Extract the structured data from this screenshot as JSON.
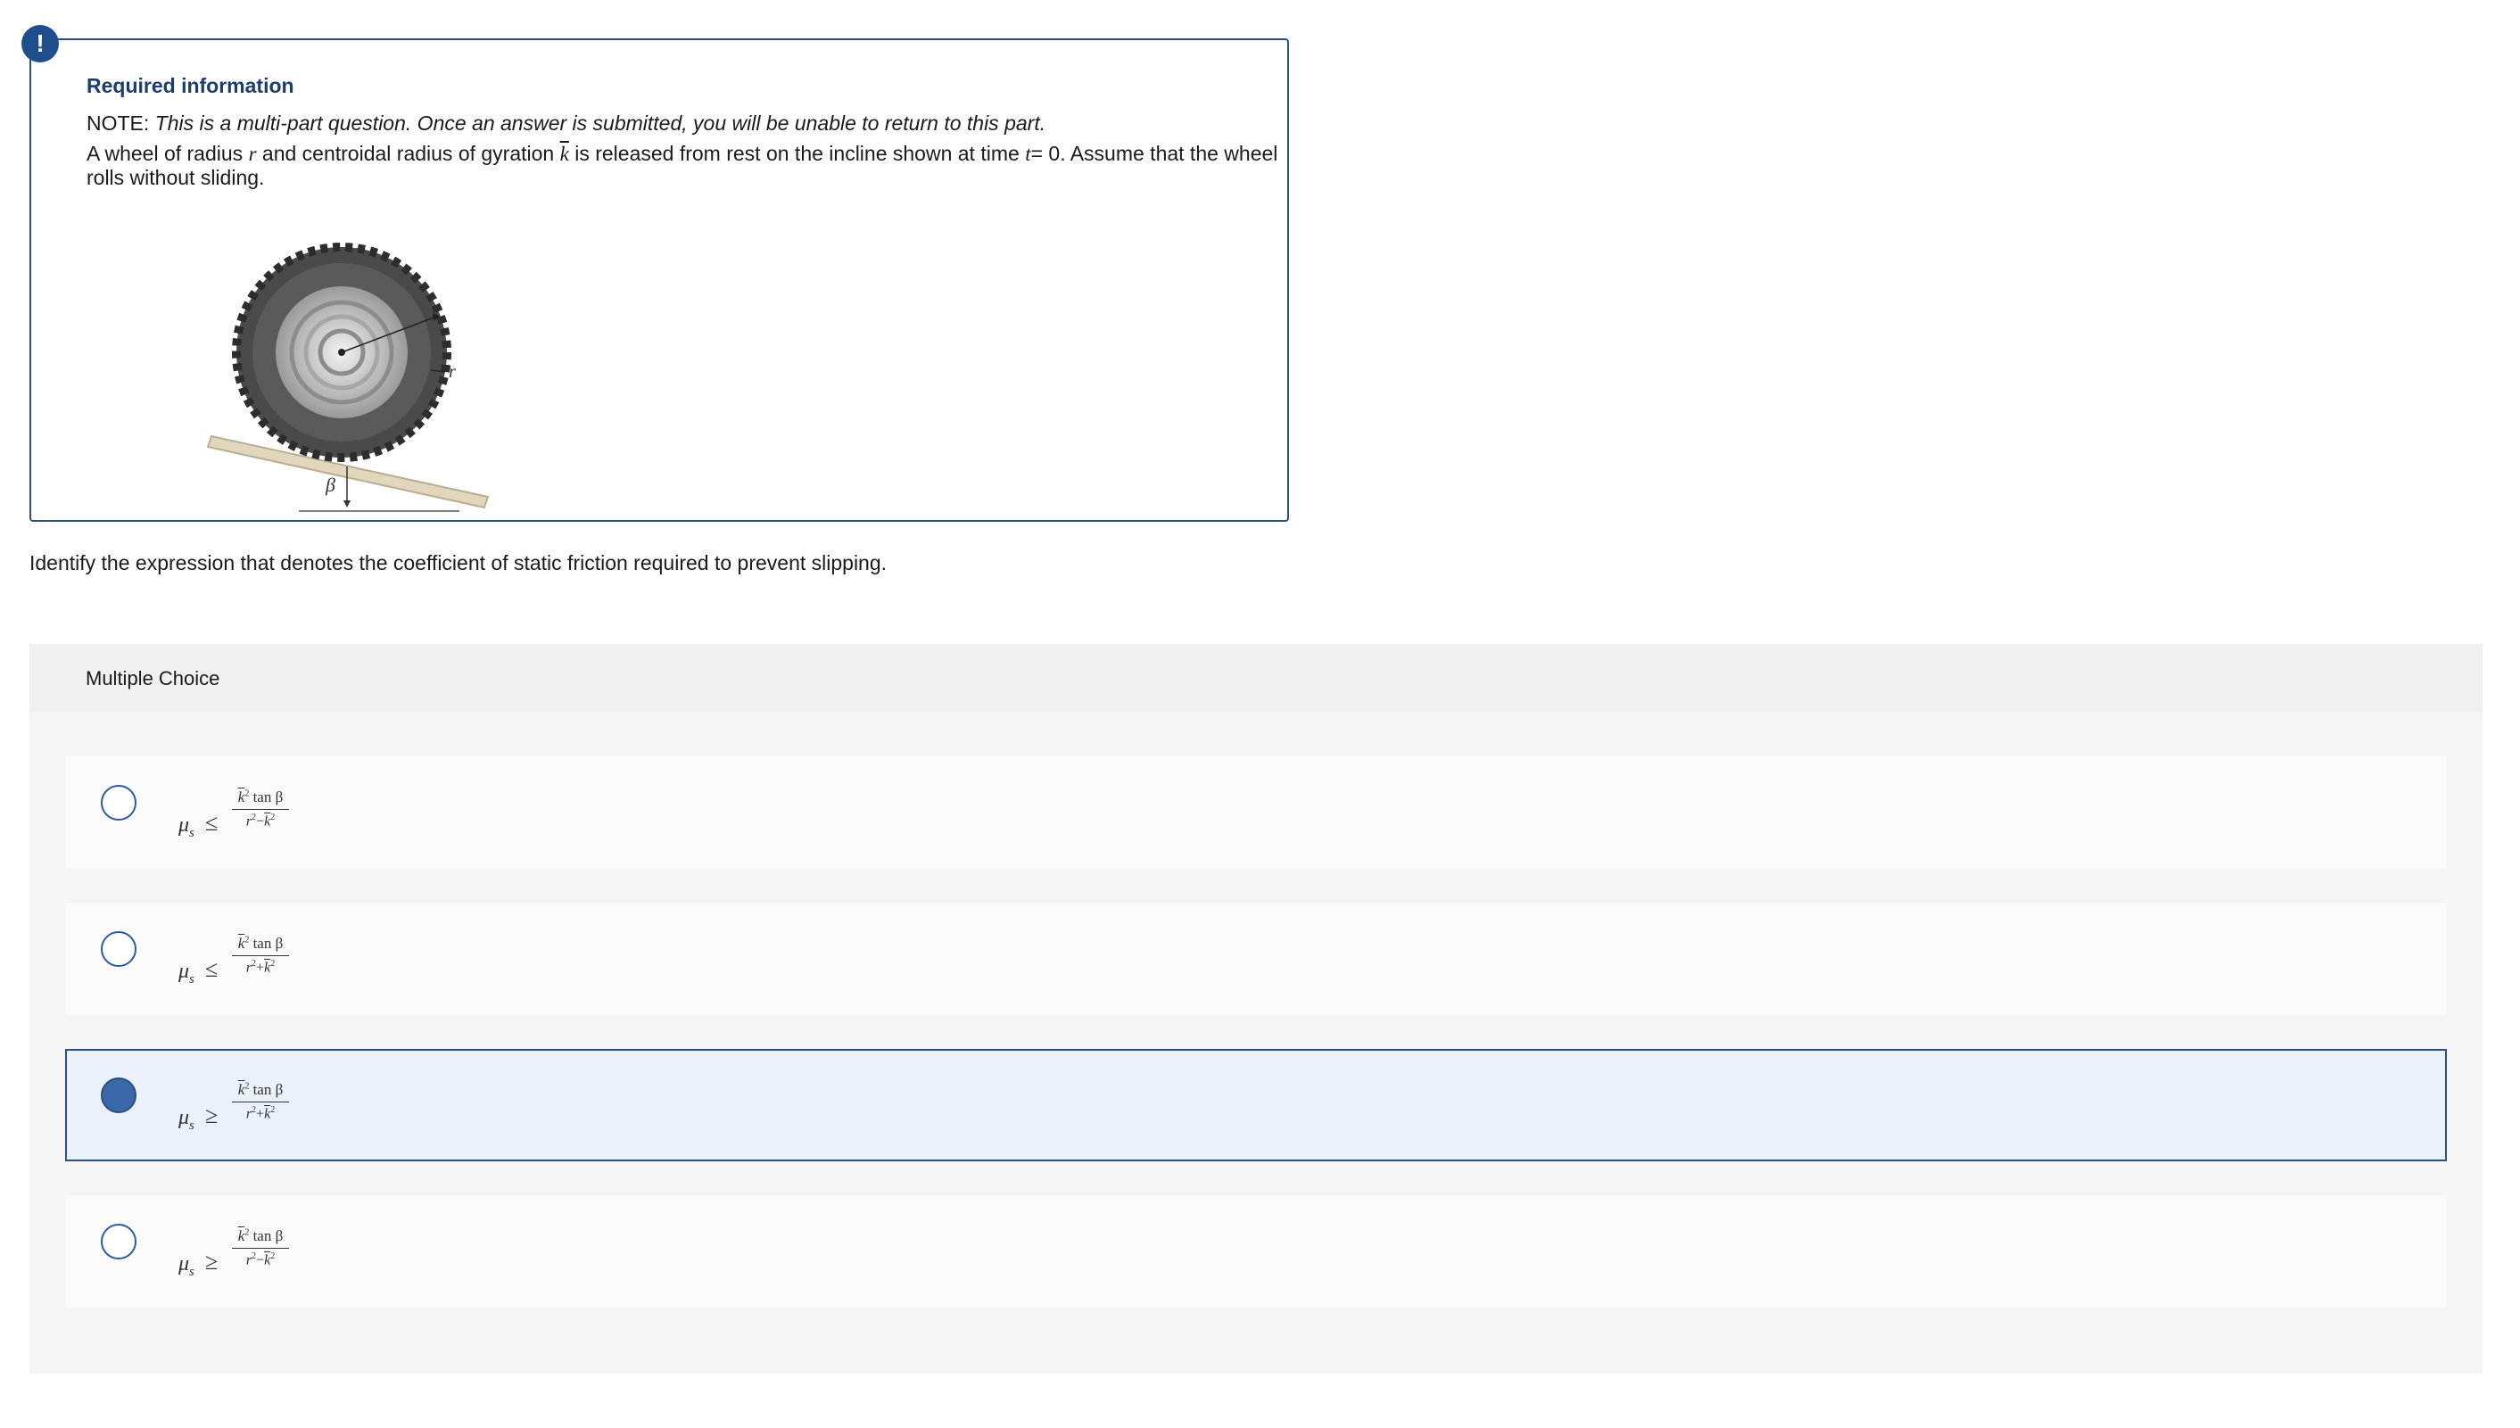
{
  "info": {
    "title": "Required information",
    "note_prefix": "NOTE:",
    "note_body": "This is a multi-part question. Once an answer is submitted, you will be unable to return to this part.",
    "problem_a": "A wheel of radius",
    "problem_r": "r",
    "problem_b": "and centroidal radius of gyration",
    "problem_k": "k",
    "problem_c": "is released from rest on the incline shown at time",
    "problem_t": "t",
    "problem_d": "= 0. Assume that the wheel rolls without sliding.",
    "figure_labels": {
      "radius": "r",
      "angle": "β"
    }
  },
  "question": "Identify the expression that denotes the coefficient of static friction required to prevent slipping.",
  "multiple_choice": {
    "label": "Multiple Choice",
    "selected_index": 2,
    "options": [
      {
        "mu": "μ",
        "sub": "s",
        "relation": "≤",
        "num_k": "k",
        "num_rest": "tan β",
        "den_r": "r",
        "den_op": "−",
        "den_k": "k"
      },
      {
        "mu": "μ",
        "sub": "s",
        "relation": "≤",
        "num_k": "k",
        "num_rest": "tan β",
        "den_r": "r",
        "den_op": "+",
        "den_k": "k"
      },
      {
        "mu": "μ",
        "sub": "s",
        "relation": "≥",
        "num_k": "k",
        "num_rest": "tan β",
        "den_r": "r",
        "den_op": "+",
        "den_k": "k"
      },
      {
        "mu": "μ",
        "sub": "s",
        "relation": "≥",
        "num_k": "k",
        "num_rest": "tan β",
        "den_r": "r",
        "den_op": "−",
        "den_k": "k"
      }
    ]
  },
  "colors": {
    "accent": "#2c4f7c",
    "selected_bg": "#eaf1fa",
    "radio_fill": "#3b68a8"
  }
}
